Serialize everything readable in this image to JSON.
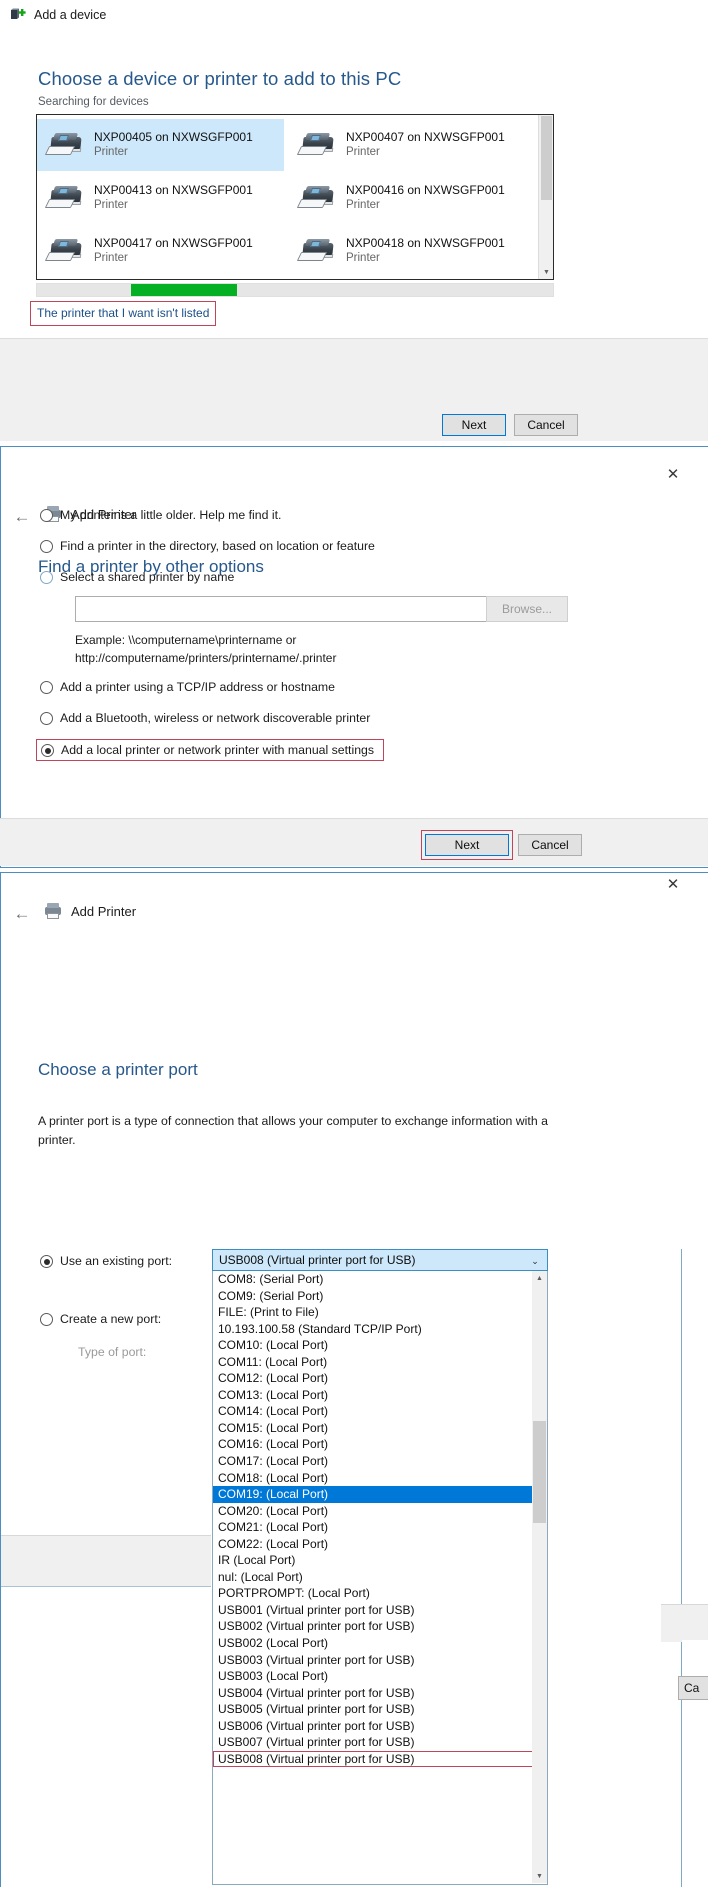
{
  "add_device_window": {
    "titlebar": {
      "icon": "add-device-icon",
      "title": "Add a device"
    },
    "heading": "Choose a device or printer to add to this PC",
    "status": "Searching for devices",
    "devices": [
      {
        "name": "NXP00405 on NXWSGFP001",
        "type": "Printer",
        "selected": true
      },
      {
        "name": "NXP00407 on NXWSGFP001",
        "type": "Printer",
        "selected": false
      },
      {
        "name": "NXP00413 on NXWSGFP001",
        "type": "Printer",
        "selected": false
      },
      {
        "name": "NXP00416 on NXWSGFP001",
        "type": "Printer",
        "selected": false
      },
      {
        "name": "NXP00417 on NXWSGFP001",
        "type": "Printer",
        "selected": false
      },
      {
        "name": "NXP00418 on NXWSGFP001",
        "type": "Printer",
        "selected": false
      }
    ],
    "progress_percent": 20,
    "link": "The printer that I want isn't listed",
    "buttons": {
      "next": "Next",
      "cancel": "Cancel"
    },
    "scroll_up_glyph": "▲",
    "scroll_down_glyph": "▼"
  },
  "other_options_window": {
    "close_glyph": "✕",
    "back_glyph": "←",
    "brand": "Add Printer",
    "heading": "Find a printer by other options",
    "options": [
      {
        "label": "My printer is a little older. Help me find it.",
        "selected": false
      },
      {
        "label": "Find a printer in the directory, based on location or feature",
        "selected": false
      },
      {
        "label": "Select a shared printer by name",
        "selected": false
      },
      {
        "label": "Add a printer using a TCP/IP address or hostname",
        "selected": false
      },
      {
        "label": "Add a Bluetooth, wireless or network discoverable printer",
        "selected": false
      },
      {
        "label": "Add a local printer or network printer with manual settings",
        "selected": true
      }
    ],
    "shared_printer_value": "",
    "shared_printer_placeholder": "",
    "browse_label": "Browse...",
    "example_line1": "Example: \\\\computername\\printername or",
    "example_line2": "http://computername/printers/printername/.printer",
    "buttons": {
      "next": "Next",
      "cancel": "Cancel"
    }
  },
  "printer_port_window": {
    "close_glyph": "✕",
    "back_glyph": "←",
    "brand": "Add Printer",
    "heading": "Choose a printer port",
    "description": "A printer port is a type of connection that allows your computer to exchange information with a printer.",
    "use_existing_label": "Use an existing port:",
    "create_new_label": "Create a new port:",
    "type_of_port_label": "Type of port:",
    "combo_value": "USB008 (Virtual printer port for USB)",
    "caret_glyph": "⌄",
    "scroll_up_glyph": "▲",
    "scroll_down_glyph": "▼",
    "cancel_partial": "Ca",
    "port_options": [
      {
        "label": "COM8: (Serial Port)"
      },
      {
        "label": "COM9: (Serial Port)"
      },
      {
        "label": "FILE: (Print to File)"
      },
      {
        "label": "10.193.100.58 (Standard TCP/IP Port)"
      },
      {
        "label": "COM10: (Local Port)"
      },
      {
        "label": "COM11: (Local Port)"
      },
      {
        "label": "COM12: (Local Port)"
      },
      {
        "label": "COM13: (Local Port)"
      },
      {
        "label": "COM14: (Local Port)"
      },
      {
        "label": "COM15: (Local Port)"
      },
      {
        "label": "COM16: (Local Port)"
      },
      {
        "label": "COM17: (Local Port)"
      },
      {
        "label": "COM18: (Local Port)"
      },
      {
        "label": "COM19: (Local Port)",
        "highlighted_selection": true
      },
      {
        "label": "COM20: (Local Port)"
      },
      {
        "label": "COM21: (Local Port)"
      },
      {
        "label": "COM22: (Local Port)"
      },
      {
        "label": "IR (Local Port)"
      },
      {
        "label": "nul: (Local Port)"
      },
      {
        "label": "PORTPROMPT: (Local Port)"
      },
      {
        "label": "USB001 (Virtual printer port for USB)"
      },
      {
        "label": "USB002 (Virtual printer port for USB)"
      },
      {
        "label": "USB002 (Local Port)"
      },
      {
        "label": "USB003 (Virtual printer port for USB)"
      },
      {
        "label": "USB003 (Local Port)"
      },
      {
        "label": "USB004 (Virtual printer port for USB)"
      },
      {
        "label": "USB005 (Virtual printer port for USB)"
      },
      {
        "label": "USB006 (Virtual printer port for USB)"
      },
      {
        "label": "USB007 (Virtual printer port for USB)"
      },
      {
        "label": "USB008 (Virtual printer port for USB)",
        "annotated": true
      }
    ]
  },
  "colors": {
    "accent_blue": "#0078d7",
    "heading_blue": "#26588c",
    "selection_blue": "#cde8fa",
    "annotation_red": "#c0445a",
    "progress_green": "#06b025"
  }
}
